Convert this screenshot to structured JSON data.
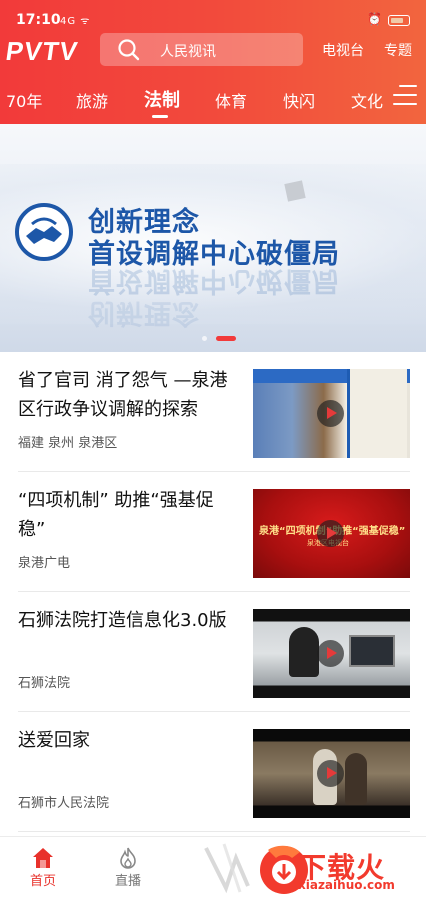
{
  "status_bar": {
    "time": "17:10",
    "signal": "4G ᯤ",
    "alarm": "⏰"
  },
  "header": {
    "logo": "PVTV",
    "search_placeholder": "人民视讯",
    "tv_link": "电视台",
    "topic_link": "专题"
  },
  "tabs": [
    {
      "label": "70年",
      "active": false
    },
    {
      "label": "旅游",
      "active": false
    },
    {
      "label": "法制",
      "active": true
    },
    {
      "label": "体育",
      "active": false
    },
    {
      "label": "快闪",
      "active": false
    },
    {
      "label": "文化",
      "active": false
    }
  ],
  "banner": {
    "line1": "创新理念",
    "line2": "首设调解中心破僵局",
    "slides": 2,
    "active_slide": 2
  },
  "news": [
    {
      "title": "省了官司 消了怨气 —泉港区行政争议调解的探索",
      "source": "福建 泉州 泉港区"
    },
    {
      "title": "“四项机制” 助推“强基促稳”",
      "source": "泉港广电",
      "thumb_text": "泉港“四项机制”助推“强基促稳”",
      "thumb_sub": "泉港区电视台"
    },
    {
      "title": "石狮法院打造信息化3.0版",
      "source": "石狮法院"
    },
    {
      "title": "送爱回家",
      "source": "石狮市人民法院"
    }
  ],
  "bottom_nav": [
    {
      "label": "首页",
      "active": true
    },
    {
      "label": "直播",
      "active": false
    }
  ],
  "watermark": {
    "text": "下载火",
    "sub": "xiazaihuo.com"
  },
  "colors": {
    "brand_red": "#f23a3a",
    "banner_text": "#1d57a8"
  }
}
